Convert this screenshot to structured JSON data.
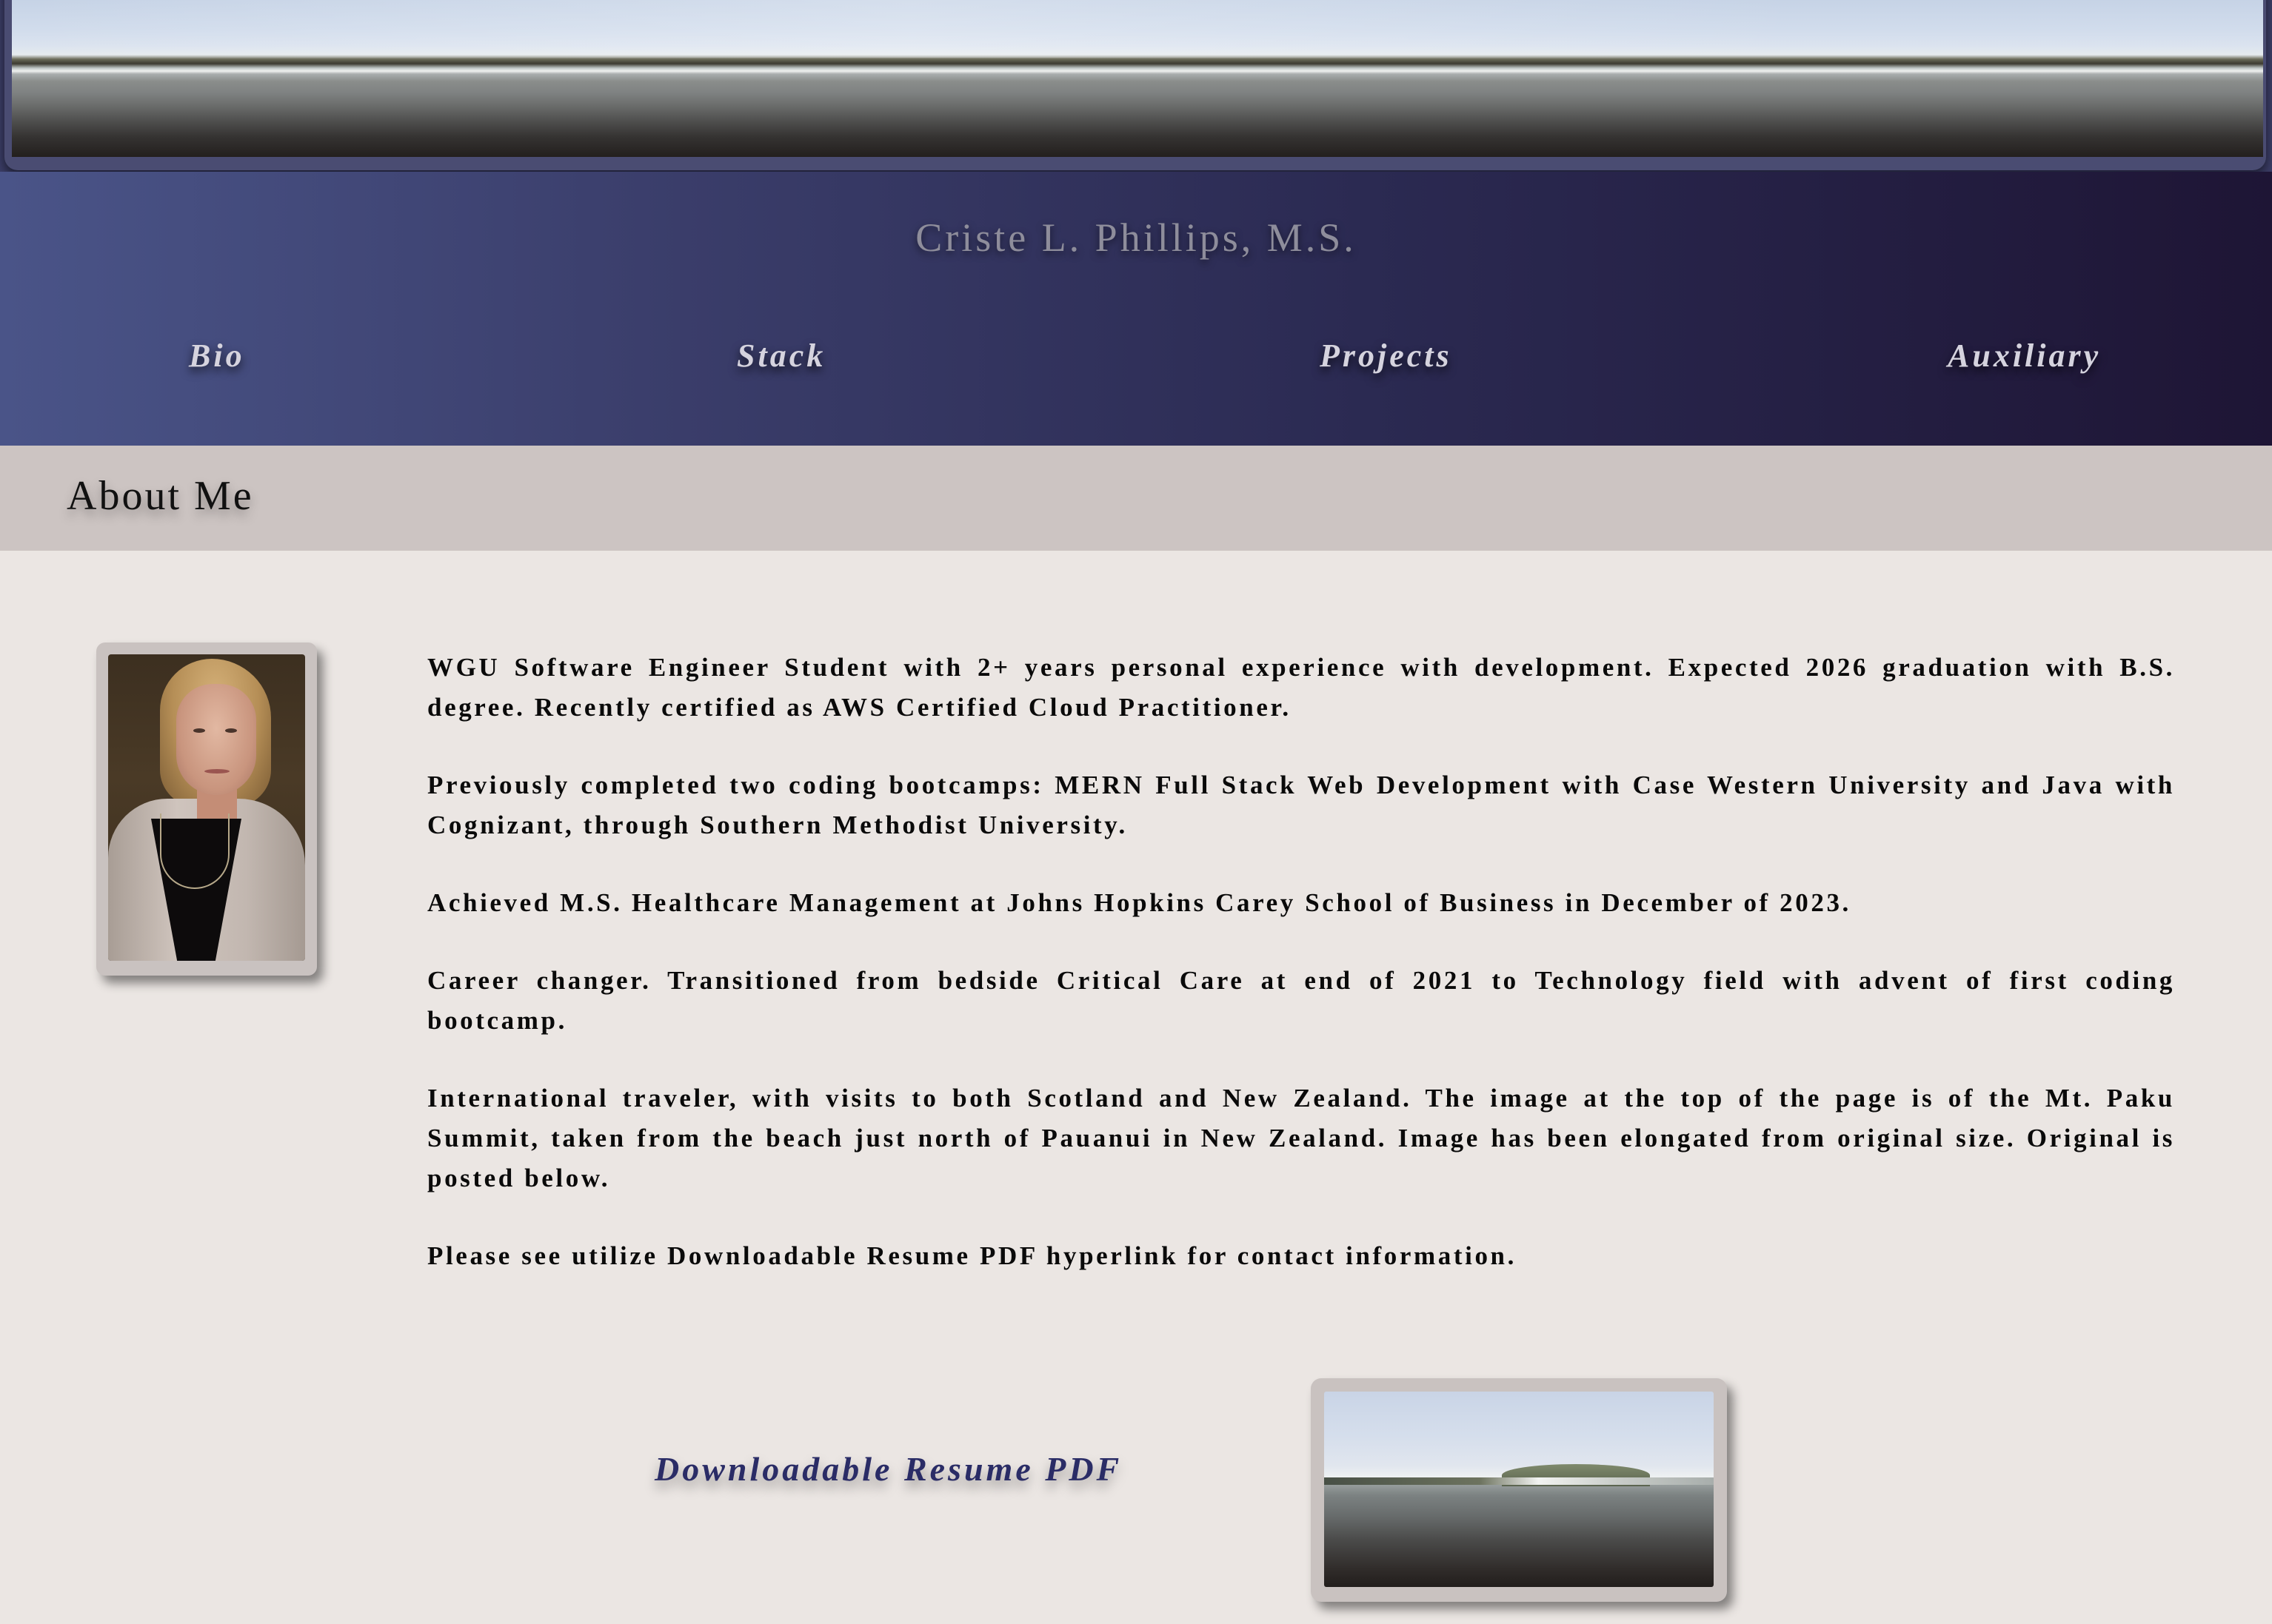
{
  "header": {
    "site_title": "Criste L. Phillips, M.S."
  },
  "nav": {
    "items": [
      {
        "label": "Bio"
      },
      {
        "label": "Stack"
      },
      {
        "label": "Projects"
      },
      {
        "label": "Auxiliary"
      }
    ]
  },
  "about": {
    "heading": "About Me",
    "paragraphs": [
      "WGU Software Engineer Student with 2+ years personal experience with development. Expected 2026 graduation with B.S. degree. Recently certified as AWS Certified Cloud Practitioner.",
      "Previously completed two coding bootcamps: MERN Full Stack Web Development with Case Western University and Java with Cognizant, through Southern Methodist University.",
      "Achieved M.S. Healthcare Management at Johns Hopkins Carey School of Business in December of 2023.",
      "Career changer. Transitioned from bedside Critical Care at end of 2021 to Technology field with advent of first coding bootcamp.",
      "International traveler, with visits to both Scotland and New Zealand. The image at the top of the page is of the Mt. Paku Summit, taken from the beach just north of Pauanui in New Zealand. Image has been elongated from original size. Original is posted below.",
      "Please see utilize Downloadable Resume PDF hyperlink for contact information."
    ]
  },
  "resume": {
    "link_label": "Downloadable Resume PDF"
  },
  "colors": {
    "nav_gradient_start": "#4a5488",
    "nav_gradient_end": "#1e1535",
    "about_band": "#ccc4c2",
    "page_background": "#ebe6e3",
    "resume_link": "#2a2c66"
  }
}
